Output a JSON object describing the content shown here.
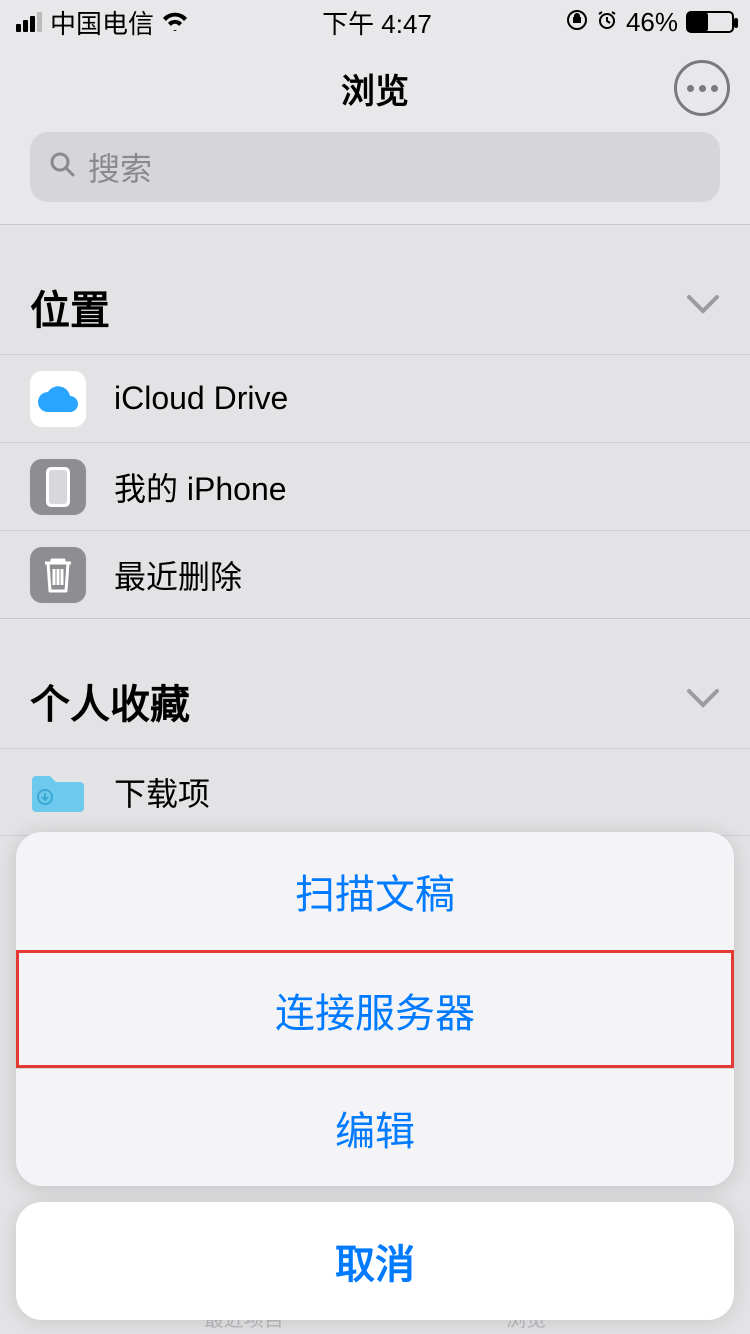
{
  "statusbar": {
    "carrier": "中国电信",
    "time": "下午 4:47",
    "battery_pct": "46%"
  },
  "nav": {
    "title": "浏览"
  },
  "search": {
    "placeholder": "搜索"
  },
  "sections": {
    "locations": {
      "title": "位置",
      "items": [
        {
          "label": "iCloud Drive"
        },
        {
          "label": "我的 iPhone"
        },
        {
          "label": "最近删除"
        }
      ]
    },
    "favorites": {
      "title": "个人收藏",
      "items": [
        {
          "label": "下载项"
        }
      ]
    }
  },
  "action_sheet": {
    "items": [
      {
        "label": "扫描文稿"
      },
      {
        "label": "连接服务器"
      },
      {
        "label": "编辑"
      }
    ],
    "cancel": "取消"
  },
  "tabbar": {
    "recent": "最近项目",
    "browse": "浏览"
  }
}
